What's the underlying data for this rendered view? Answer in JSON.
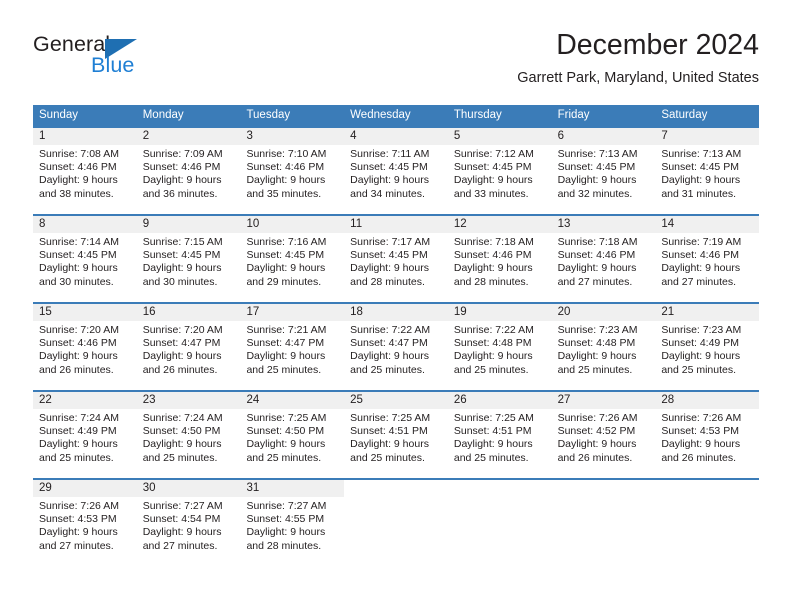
{
  "brand": {
    "name_part1": "General",
    "name_part2": "Blue",
    "triangle_color": "#1f6fb2",
    "blue_color": "#1f7fd4"
  },
  "header": {
    "title": "December 2024",
    "subtitle": "Garrett Park, Maryland, United States"
  },
  "theme": {
    "header_bg": "#3b7cb8",
    "header_text": "#ffffff",
    "daynum_band": "#f0f0f0",
    "body_text": "#231f20"
  },
  "weekday_headers": [
    "Sunday",
    "Monday",
    "Tuesday",
    "Wednesday",
    "Thursday",
    "Friday",
    "Saturday"
  ],
  "weeks": [
    {
      "days": [
        {
          "num": "1",
          "sunrise": "Sunrise: 7:08 AM",
          "sunset": "Sunset: 4:46 PM",
          "daylight1": "Daylight: 9 hours",
          "daylight2": "and 38 minutes."
        },
        {
          "num": "2",
          "sunrise": "Sunrise: 7:09 AM",
          "sunset": "Sunset: 4:46 PM",
          "daylight1": "Daylight: 9 hours",
          "daylight2": "and 36 minutes."
        },
        {
          "num": "3",
          "sunrise": "Sunrise: 7:10 AM",
          "sunset": "Sunset: 4:46 PM",
          "daylight1": "Daylight: 9 hours",
          "daylight2": "and 35 minutes."
        },
        {
          "num": "4",
          "sunrise": "Sunrise: 7:11 AM",
          "sunset": "Sunset: 4:45 PM",
          "daylight1": "Daylight: 9 hours",
          "daylight2": "and 34 minutes."
        },
        {
          "num": "5",
          "sunrise": "Sunrise: 7:12 AM",
          "sunset": "Sunset: 4:45 PM",
          "daylight1": "Daylight: 9 hours",
          "daylight2": "and 33 minutes."
        },
        {
          "num": "6",
          "sunrise": "Sunrise: 7:13 AM",
          "sunset": "Sunset: 4:45 PM",
          "daylight1": "Daylight: 9 hours",
          "daylight2": "and 32 minutes."
        },
        {
          "num": "7",
          "sunrise": "Sunrise: 7:13 AM",
          "sunset": "Sunset: 4:45 PM",
          "daylight1": "Daylight: 9 hours",
          "daylight2": "and 31 minutes."
        }
      ]
    },
    {
      "days": [
        {
          "num": "8",
          "sunrise": "Sunrise: 7:14 AM",
          "sunset": "Sunset: 4:45 PM",
          "daylight1": "Daylight: 9 hours",
          "daylight2": "and 30 minutes."
        },
        {
          "num": "9",
          "sunrise": "Sunrise: 7:15 AM",
          "sunset": "Sunset: 4:45 PM",
          "daylight1": "Daylight: 9 hours",
          "daylight2": "and 30 minutes."
        },
        {
          "num": "10",
          "sunrise": "Sunrise: 7:16 AM",
          "sunset": "Sunset: 4:45 PM",
          "daylight1": "Daylight: 9 hours",
          "daylight2": "and 29 minutes."
        },
        {
          "num": "11",
          "sunrise": "Sunrise: 7:17 AM",
          "sunset": "Sunset: 4:45 PM",
          "daylight1": "Daylight: 9 hours",
          "daylight2": "and 28 minutes."
        },
        {
          "num": "12",
          "sunrise": "Sunrise: 7:18 AM",
          "sunset": "Sunset: 4:46 PM",
          "daylight1": "Daylight: 9 hours",
          "daylight2": "and 28 minutes."
        },
        {
          "num": "13",
          "sunrise": "Sunrise: 7:18 AM",
          "sunset": "Sunset: 4:46 PM",
          "daylight1": "Daylight: 9 hours",
          "daylight2": "and 27 minutes."
        },
        {
          "num": "14",
          "sunrise": "Sunrise: 7:19 AM",
          "sunset": "Sunset: 4:46 PM",
          "daylight1": "Daylight: 9 hours",
          "daylight2": "and 27 minutes."
        }
      ]
    },
    {
      "days": [
        {
          "num": "15",
          "sunrise": "Sunrise: 7:20 AM",
          "sunset": "Sunset: 4:46 PM",
          "daylight1": "Daylight: 9 hours",
          "daylight2": "and 26 minutes."
        },
        {
          "num": "16",
          "sunrise": "Sunrise: 7:20 AM",
          "sunset": "Sunset: 4:47 PM",
          "daylight1": "Daylight: 9 hours",
          "daylight2": "and 26 minutes."
        },
        {
          "num": "17",
          "sunrise": "Sunrise: 7:21 AM",
          "sunset": "Sunset: 4:47 PM",
          "daylight1": "Daylight: 9 hours",
          "daylight2": "and 25 minutes."
        },
        {
          "num": "18",
          "sunrise": "Sunrise: 7:22 AM",
          "sunset": "Sunset: 4:47 PM",
          "daylight1": "Daylight: 9 hours",
          "daylight2": "and 25 minutes."
        },
        {
          "num": "19",
          "sunrise": "Sunrise: 7:22 AM",
          "sunset": "Sunset: 4:48 PM",
          "daylight1": "Daylight: 9 hours",
          "daylight2": "and 25 minutes."
        },
        {
          "num": "20",
          "sunrise": "Sunrise: 7:23 AM",
          "sunset": "Sunset: 4:48 PM",
          "daylight1": "Daylight: 9 hours",
          "daylight2": "and 25 minutes."
        },
        {
          "num": "21",
          "sunrise": "Sunrise: 7:23 AM",
          "sunset": "Sunset: 4:49 PM",
          "daylight1": "Daylight: 9 hours",
          "daylight2": "and 25 minutes."
        }
      ]
    },
    {
      "days": [
        {
          "num": "22",
          "sunrise": "Sunrise: 7:24 AM",
          "sunset": "Sunset: 4:49 PM",
          "daylight1": "Daylight: 9 hours",
          "daylight2": "and 25 minutes."
        },
        {
          "num": "23",
          "sunrise": "Sunrise: 7:24 AM",
          "sunset": "Sunset: 4:50 PM",
          "daylight1": "Daylight: 9 hours",
          "daylight2": "and 25 minutes."
        },
        {
          "num": "24",
          "sunrise": "Sunrise: 7:25 AM",
          "sunset": "Sunset: 4:50 PM",
          "daylight1": "Daylight: 9 hours",
          "daylight2": "and 25 minutes."
        },
        {
          "num": "25",
          "sunrise": "Sunrise: 7:25 AM",
          "sunset": "Sunset: 4:51 PM",
          "daylight1": "Daylight: 9 hours",
          "daylight2": "and 25 minutes."
        },
        {
          "num": "26",
          "sunrise": "Sunrise: 7:25 AM",
          "sunset": "Sunset: 4:51 PM",
          "daylight1": "Daylight: 9 hours",
          "daylight2": "and 25 minutes."
        },
        {
          "num": "27",
          "sunrise": "Sunrise: 7:26 AM",
          "sunset": "Sunset: 4:52 PM",
          "daylight1": "Daylight: 9 hours",
          "daylight2": "and 26 minutes."
        },
        {
          "num": "28",
          "sunrise": "Sunrise: 7:26 AM",
          "sunset": "Sunset: 4:53 PM",
          "daylight1": "Daylight: 9 hours",
          "daylight2": "and 26 minutes."
        }
      ]
    },
    {
      "days": [
        {
          "num": "29",
          "sunrise": "Sunrise: 7:26 AM",
          "sunset": "Sunset: 4:53 PM",
          "daylight1": "Daylight: 9 hours",
          "daylight2": "and 27 minutes."
        },
        {
          "num": "30",
          "sunrise": "Sunrise: 7:27 AM",
          "sunset": "Sunset: 4:54 PM",
          "daylight1": "Daylight: 9 hours",
          "daylight2": "and 27 minutes."
        },
        {
          "num": "31",
          "sunrise": "Sunrise: 7:27 AM",
          "sunset": "Sunset: 4:55 PM",
          "daylight1": "Daylight: 9 hours",
          "daylight2": "and 28 minutes."
        },
        {
          "num": "",
          "sunrise": "",
          "sunset": "",
          "daylight1": "",
          "daylight2": ""
        },
        {
          "num": "",
          "sunrise": "",
          "sunset": "",
          "daylight1": "",
          "daylight2": ""
        },
        {
          "num": "",
          "sunrise": "",
          "sunset": "",
          "daylight1": "",
          "daylight2": ""
        },
        {
          "num": "",
          "sunrise": "",
          "sunset": "",
          "daylight1": "",
          "daylight2": ""
        }
      ]
    }
  ]
}
